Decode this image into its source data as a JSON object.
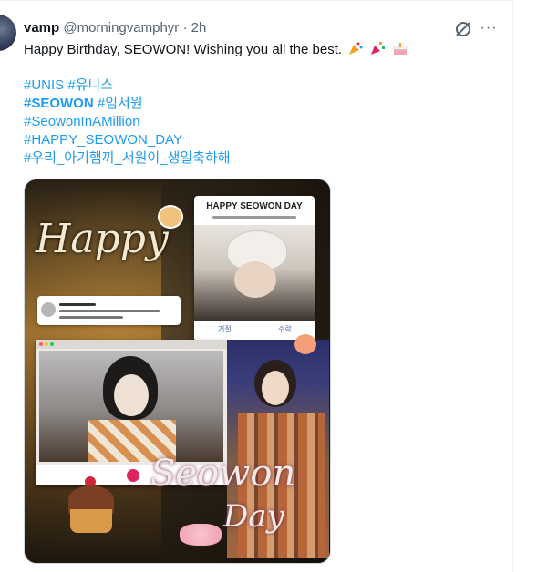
{
  "tweet": {
    "author": {
      "name": "vamp",
      "handle": "@morningvamphyr",
      "separator": "·",
      "time": "2h"
    },
    "text": {
      "greeting": "Happy Birthday, SEOWON! Wishing you all the best."
    },
    "hashtags": {
      "unis": "#UNIS",
      "unis_kr": "#유니스",
      "seowon": "#SEOWON",
      "seowon_kr": "#임서원",
      "million": "#SeowonInAMillion",
      "happy": "#HAPPY_SEOWON_DAY",
      "korean_long": "#우리_아기햄끼_서원이_생일축하해"
    },
    "emojis": [
      "party-popper-icon",
      "confetti-icon",
      "cake-icon"
    ],
    "more_label": "···"
  },
  "media": {
    "card_title": "HAPPY SEOWON DAY",
    "card_button_left": "거절",
    "card_button_right": "수락",
    "happy_text": "Happy",
    "seowon_text": "Seowon",
    "day_text": "Day"
  },
  "colors": {
    "link": "#1d9bf0",
    "text": "#0f1419",
    "muted": "#536471"
  }
}
